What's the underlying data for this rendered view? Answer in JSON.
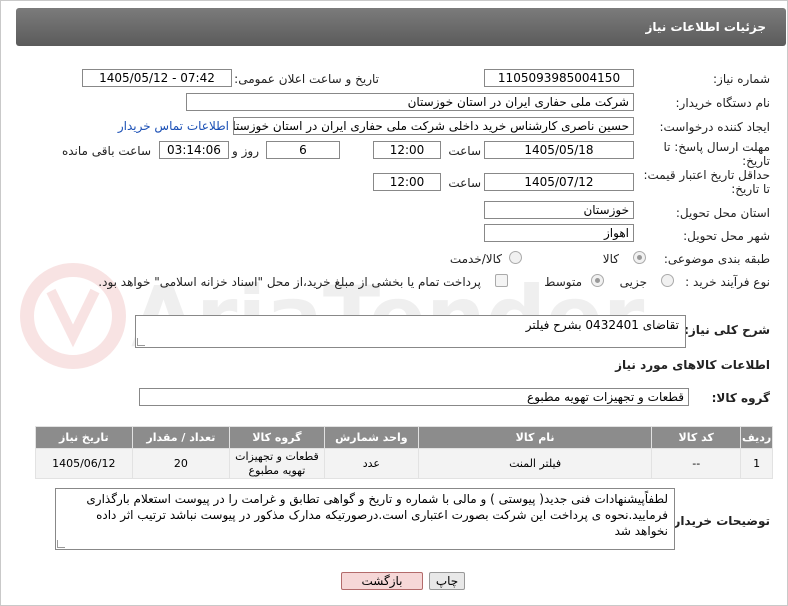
{
  "header": {
    "title": "جزئیات اطلاعات نیاز"
  },
  "fields": {
    "need_number_label": "شماره نیاز:",
    "need_number": "1105093985004150",
    "announce_label": "تاریخ و ساعت اعلان عمومی:",
    "announce_value": "1405/05/12 - 07:42",
    "buyer_org_label": "نام دستگاه خریدار:",
    "buyer_org": "شرکت ملی حفاری ایران در استان خوزستان",
    "creator_label": "ایجاد کننده درخواست:",
    "creator": "حسین ناصری کارشناس خرید داخلی شرکت ملی حفاری ایران در استان خوزستان",
    "contact_link": "اطلاعات تماس خریدار",
    "reply_deadline_label_1": "مهلت ارسال پاسخ: تا",
    "reply_deadline_label_2": "تاریخ:",
    "reply_date": "1405/05/18",
    "time_label": "ساعت",
    "reply_time": "12:00",
    "days": "6",
    "days_label": "روز و",
    "remaining": "03:14:06",
    "remaining_label": "ساعت باقی مانده",
    "price_deadline_label_1": "حداقل تاریخ اعتبار قیمت:",
    "price_deadline_label_2": "تا تاریخ:",
    "price_date": "1405/07/12",
    "price_time": "12:00",
    "province_label": "استان محل تحویل:",
    "province": "خوزستان",
    "city_label": "شهر محل تحویل:",
    "city": "اهواز",
    "category_label": "طبقه بندی موضوعی:",
    "category_options": [
      "کالا",
      "کالا/خدمت"
    ],
    "process_label": "نوع فرآیند خرید :",
    "process_options": [
      "جزیی",
      "متوسط"
    ],
    "payment_note": "پرداخت تمام یا بخشی از مبلغ خرید،از محل \"اسناد خزانه اسلامی\" خواهد بود.",
    "description_label": "شرح کلی نیاز:",
    "description": "تقاضای 0432401 بشرح فیلتر"
  },
  "goods": {
    "section_title": "اطلاعات کالاهای مورد نیاز",
    "group_label": "گروه کالا:",
    "group_value": "قطعات و تجهیزات تهویه مطبوع",
    "columns": [
      "ردیف",
      "کد کالا",
      "نام کالا",
      "واحد شمارش",
      "گروه کالا",
      "تعداد / مقدار",
      "تاریخ نیاز"
    ],
    "rows": [
      [
        "1",
        "--",
        "فیلتر المنت",
        "عدد",
        "قطعات و تجهیزات تهویه مطبوع",
        "20",
        "1405/06/12"
      ]
    ]
  },
  "buyer_notes": {
    "label": "توضیحات خریدار:",
    "text": "لطفاًپیشنهادات فنی جدید( پیوستی ) و مالی با شماره و تاریخ و گواهی تطابق و غرامت را در پیوست استعلام بارگذاری فرمایید.نحوه ی پرداخت این شرکت بصورت اعتباری است.درصورتیکه مدارک مذکور در پیوست نباشد ترتیب اثر داده نخواهد شد"
  },
  "buttons": {
    "print": "چاپ",
    "back": "بازگشت"
  },
  "watermark": {
    "text": "AriaTender.net"
  }
}
